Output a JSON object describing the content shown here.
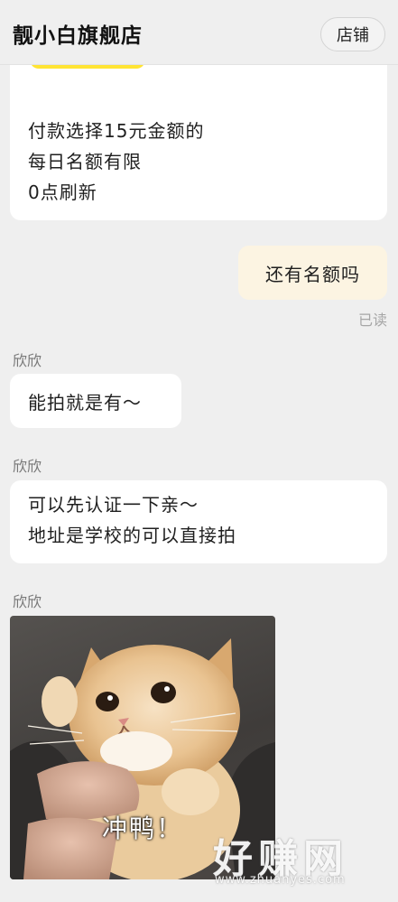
{
  "header": {
    "title": "靓小白旗舰店",
    "store_button": "店铺"
  },
  "messages": {
    "promo_lines": [
      "付款选择15元金额的",
      "每日名额有限",
      "0点刷新"
    ],
    "my_message": "还有名额吗",
    "read_status": "已读",
    "sender_name": "欣欣",
    "reply_1": "能拍就是有～",
    "reply_2_lines": [
      "可以先认证一下亲～",
      "地址是学校的可以直接拍"
    ],
    "sticker_caption": "冲鸭！"
  },
  "watermark": {
    "logo_text": "好赚网",
    "url_text": "www.zhuanyes.com"
  },
  "colors": {
    "background": "#efefef",
    "my_bubble": "#fcf4e2",
    "other_bubble": "#ffffff",
    "accent_yellow": "#ffe433"
  }
}
